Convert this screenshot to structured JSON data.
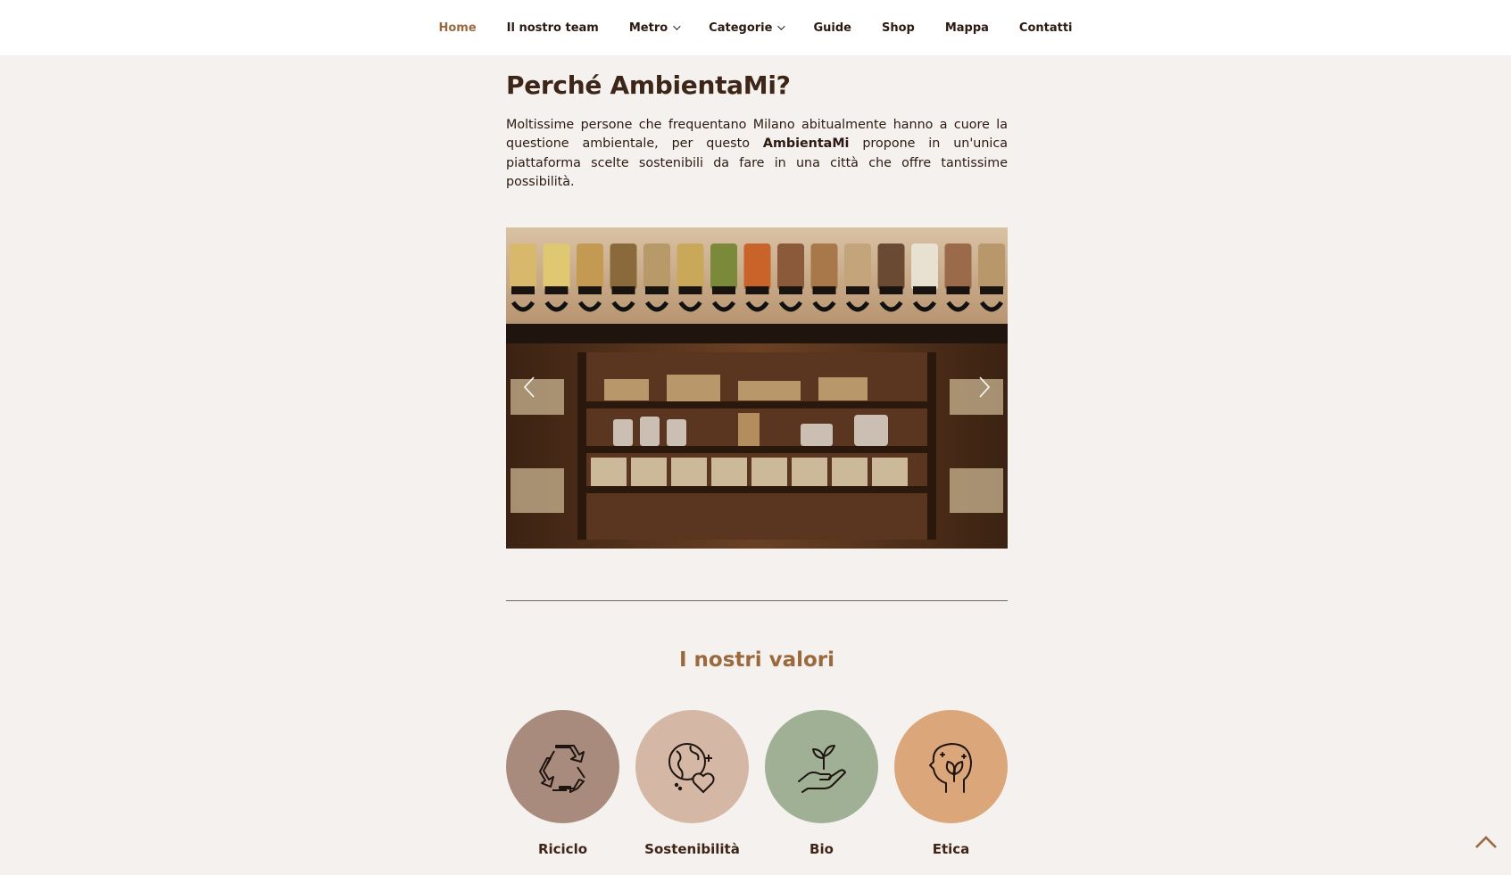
{
  "nav": {
    "items": [
      {
        "label": "Home",
        "active": true,
        "dropdown": false
      },
      {
        "label": "Il nostro team",
        "active": false,
        "dropdown": false
      },
      {
        "label": "Metro",
        "active": false,
        "dropdown": true
      },
      {
        "label": "Categorie",
        "active": false,
        "dropdown": true
      },
      {
        "label": "Guide",
        "active": false,
        "dropdown": false
      },
      {
        "label": "Shop",
        "active": false,
        "dropdown": false
      },
      {
        "label": "Mappa",
        "active": false,
        "dropdown": false
      },
      {
        "label": "Contatti",
        "active": false,
        "dropdown": false
      }
    ]
  },
  "main": {
    "title": "Perché AmbientaMi?",
    "intro_before": "Moltissime persone che frequentano Milano abitualmente hanno a cuore la questione ambientale, per questo ",
    "intro_bold": "AmbientaMi",
    "intro_after": " propone in un'unica piattaforma scelte sostenibili da fare in una città che offre tantissime possibilità."
  },
  "carousel": {
    "image": "bulk-food-store-shelves",
    "prev_icon": "chevron-left-icon",
    "next_icon": "chevron-right-icon"
  },
  "values": {
    "title": "I nostri valori",
    "items": [
      {
        "label": "Riciclo",
        "icon": "recycle-icon",
        "color": "#a98b7e"
      },
      {
        "label": "Sostenibilità",
        "icon": "earth-heart-icon",
        "color": "#d4b7a4"
      },
      {
        "label": "Bio",
        "icon": "plant-hand-icon",
        "color": "#9fb094"
      },
      {
        "label": "Etica",
        "icon": "head-leaf-icon",
        "color": "#dba67a"
      }
    ]
  },
  "colors": {
    "background": "#f5f1ee",
    "accent": "#9a6a3e",
    "text": "#2b1a12"
  }
}
